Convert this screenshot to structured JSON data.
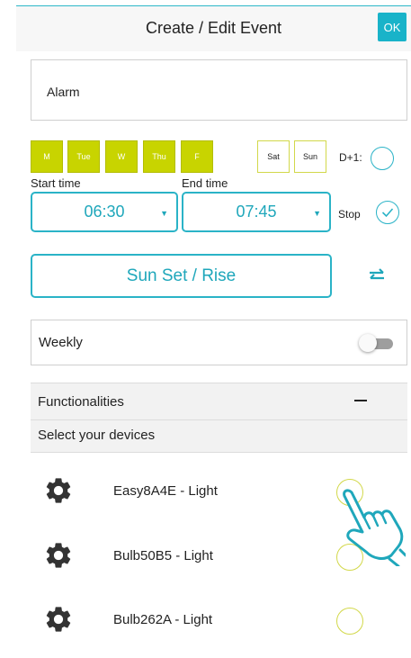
{
  "header": {
    "title": "Create / Edit Event",
    "ok_label": "OK"
  },
  "event": {
    "name": "Alarm"
  },
  "days": [
    {
      "label": "M",
      "selected": true
    },
    {
      "label": "Tue",
      "selected": true
    },
    {
      "label": "W",
      "selected": true
    },
    {
      "label": "Thu",
      "selected": true
    },
    {
      "label": "F",
      "selected": true
    },
    {
      "label": "Sat",
      "selected": false
    },
    {
      "label": "Sun",
      "selected": false
    }
  ],
  "d_plus_one": {
    "label": "D+1:",
    "checked": false
  },
  "start_time": {
    "label": "Start time",
    "value": "06:30"
  },
  "end_time": {
    "label": "End time",
    "value": "07:45"
  },
  "stop": {
    "label": "Stop",
    "checked": true
  },
  "sun_button": {
    "label": "Sun Set / Rise"
  },
  "weekly": {
    "label": "Weekly",
    "enabled": false
  },
  "functionalities": {
    "title": "Functionalities",
    "collapse_symbol": "−"
  },
  "devices_section": {
    "title": "Select your devices"
  },
  "devices": [
    {
      "name": "Easy8A4E - Light",
      "icon": "gear-icon",
      "selected": false
    },
    {
      "name": "Bulb50B5 - Light",
      "icon": "gear-icon",
      "selected": false
    },
    {
      "name": "Bulb262A - Light",
      "icon": "gear-icon",
      "selected": false
    }
  ],
  "colors": {
    "accent": "#1fa7bb",
    "day_selected": "#c8d400",
    "circle_border": "#d2d84a"
  }
}
